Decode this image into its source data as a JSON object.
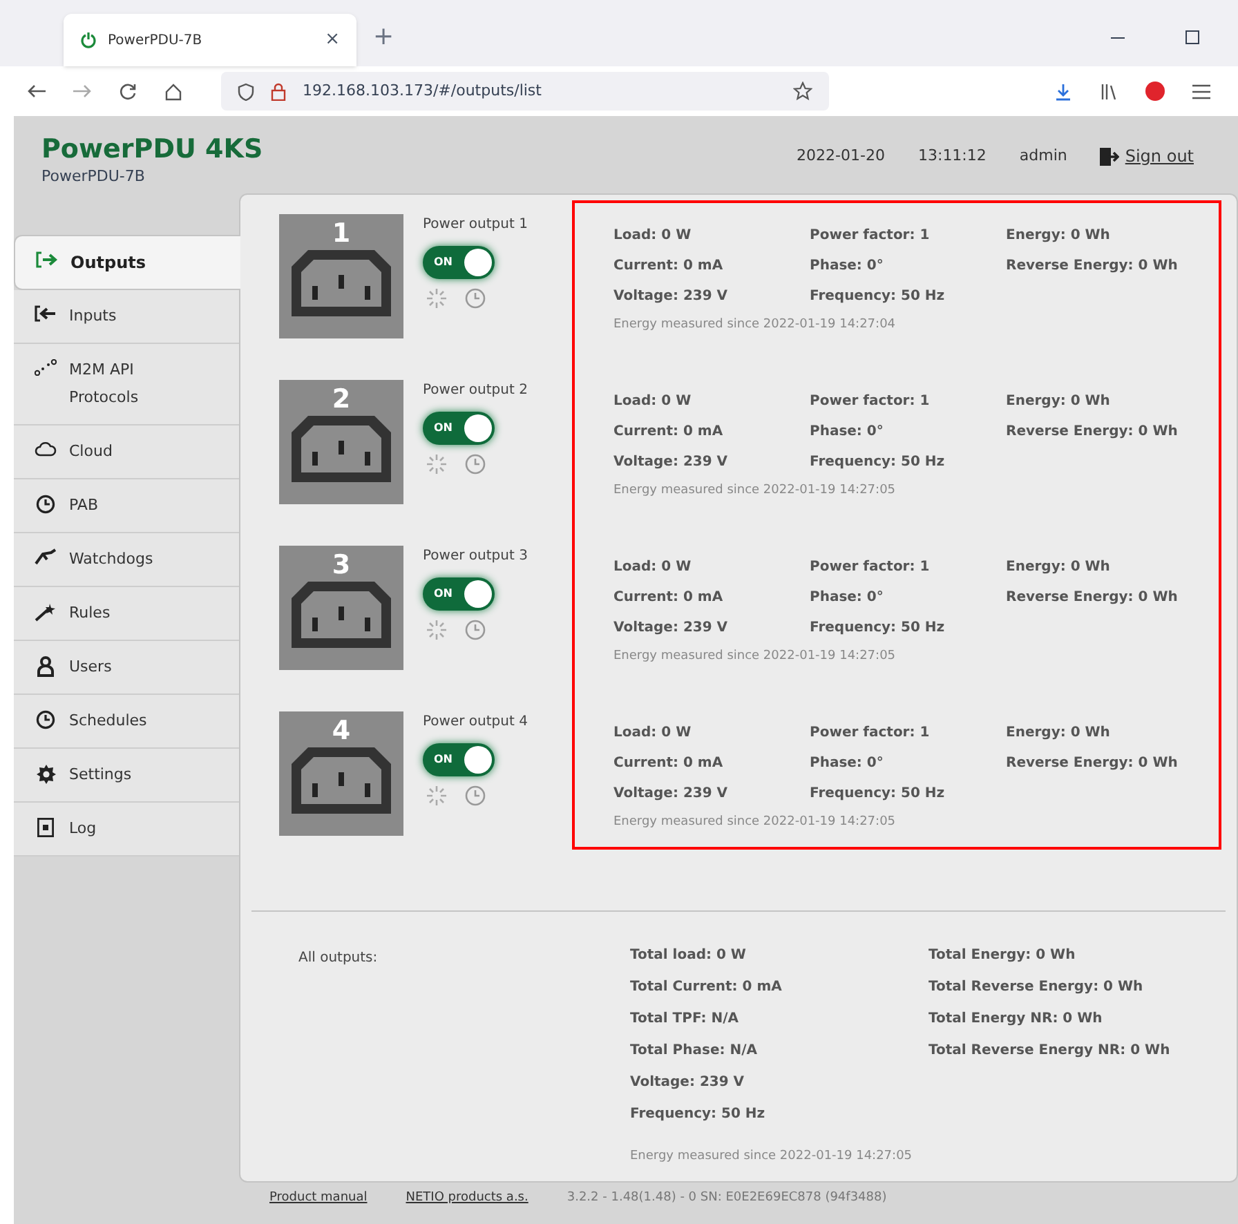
{
  "browser": {
    "tab_title": "PowerPDU-7B",
    "tab_close": "×",
    "new_tab": "+",
    "url": "192.168.103.173/#/outputs/list"
  },
  "header": {
    "title": "PowerPDU 4KS",
    "subtitle": "PowerPDU-7B",
    "date": "2022-01-20",
    "time": "13:11:12",
    "user": "admin",
    "sign_out": "Sign out"
  },
  "sidebar": {
    "items": [
      {
        "label": "Outputs",
        "selected": true
      },
      {
        "label": "Inputs",
        "selected": false
      },
      {
        "label": "M2M API Protocols",
        "selected": false
      },
      {
        "label": "Cloud",
        "selected": false
      },
      {
        "label": "PAB",
        "selected": false
      },
      {
        "label": "Watchdogs",
        "selected": false
      },
      {
        "label": "Rules",
        "selected": false
      },
      {
        "label": "Users",
        "selected": false
      },
      {
        "label": "Schedules",
        "selected": false
      },
      {
        "label": "Settings",
        "selected": false
      },
      {
        "label": "Log",
        "selected": false
      }
    ]
  },
  "outputs": [
    {
      "number": "1",
      "name": "Power output 1",
      "on": true,
      "switch_label": "ON",
      "columns": [
        [
          "Load: 0 W",
          "Current: 0 mA",
          "Voltage: 239 V"
        ],
        [
          "Power factor: 1",
          "Phase: 0°",
          "Frequency: 50 Hz"
        ],
        [
          "Energy: 0 Wh",
          "Reverse Energy: 0 Wh"
        ]
      ],
      "since": "Energy measured since 2022-01-19 14:27:04"
    },
    {
      "number": "2",
      "name": "Power output 2",
      "on": true,
      "switch_label": "ON",
      "columns": [
        [
          "Load: 0 W",
          "Current: 0 mA",
          "Voltage: 239 V"
        ],
        [
          "Power factor: 1",
          "Phase: 0°",
          "Frequency: 50 Hz"
        ],
        [
          "Energy: 0 Wh",
          "Reverse Energy: 0 Wh"
        ]
      ],
      "since": "Energy measured since 2022-01-19 14:27:05"
    },
    {
      "number": "3",
      "name": "Power output 3",
      "on": true,
      "switch_label": "ON",
      "columns": [
        [
          "Load: 0 W",
          "Current: 0 mA",
          "Voltage: 239 V"
        ],
        [
          "Power factor: 1",
          "Phase: 0°",
          "Frequency: 50 Hz"
        ],
        [
          "Energy: 0 Wh",
          "Reverse Energy: 0 Wh"
        ]
      ],
      "since": "Energy measured since 2022-01-19 14:27:05"
    },
    {
      "number": "4",
      "name": "Power output 4",
      "on": true,
      "switch_label": "ON",
      "columns": [
        [
          "Load: 0 W",
          "Current: 0 mA",
          "Voltage: 239 V"
        ],
        [
          "Power factor: 1",
          "Phase: 0°",
          "Frequency: 50 Hz"
        ],
        [
          "Energy: 0 Wh",
          "Reverse Energy: 0 Wh"
        ]
      ],
      "since": "Energy measured since 2022-01-19 14:27:05"
    }
  ],
  "summary": {
    "label": "All outputs:",
    "columns": [
      [
        "Total load: 0 W",
        "Total Current: 0 mA",
        "Total TPF: N/A",
        "Total Phase: N/A",
        "Voltage: 239 V",
        "Frequency: 50 Hz"
      ],
      [
        "Total Energy: 0 Wh",
        "Total Reverse Energy: 0 Wh",
        "Total Energy NR: 0 Wh",
        "Total Reverse Energy NR: 0 Wh"
      ]
    ],
    "since": "Energy measured since 2022-01-19 14:27:05"
  },
  "footer": {
    "links": [
      "Product manual",
      "NETIO products a.s."
    ],
    "version": "3.2.2 - 1.48(1.48) - 0 SN: E0E2E69EC878 (94f3488)"
  }
}
